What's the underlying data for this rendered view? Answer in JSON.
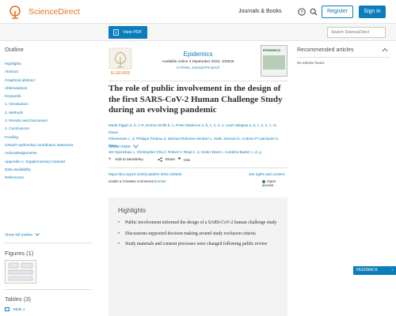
{
  "header": {
    "brand": "ScienceDirect",
    "journals_books": "Journals & Books",
    "register": "Register",
    "sign_in": "Sign in"
  },
  "toolbar": {
    "view_pdf": "View PDF",
    "search_placeholder": "Search ScienceDirect"
  },
  "outline": {
    "title": "Outline",
    "items": [
      "Highlights",
      "Abstract",
      "Graphical abstract",
      "Abbreviations",
      "Keywords",
      "1. Introduction",
      "2. Methods",
      "3. Results and Discussion",
      "4. Conclusions",
      "Funding",
      "CRediT authorship contribution statement",
      "Acknowledgements",
      "Appendix A. Supplementary material",
      "Data availability",
      "References"
    ],
    "show_full": "Show full outline"
  },
  "figures": {
    "title": "Figures (1)"
  },
  "tables": {
    "title": "Tables (3)",
    "table1": "Table 1"
  },
  "article": {
    "journal": "Epidemics",
    "available": "Available online 3 September 2022, 100626",
    "in_press": "In Press, Journal Pre-proof",
    "title": "The role of public involvement in the design of the first SARS-CoV-2 Human Challenge Study during an evolving pandemic",
    "authors_line1": "Maria Piggin a, b, 1 ✉, Emma Smith b, 1, Peter Mankone a, b, c, 2, 4, 1, Leah Ndegwa a, b, c, 2, 4, 1, ✉, Diane",
    "authors_line2": "Gbesemete c, d, Philippa Prideau d, Michael Rahman-Himbari c, Halle Johnson b, Andrew P Catchpole b, Peter",
    "authors_line3": "JM Openshaw c, Christopher Chiu f, Robert C Read c, d, Helen Ward c, Caroline Barker c, d, g",
    "show_more": "Show more",
    "add_mendeley": "Add to Mendeley",
    "share": "Share",
    "cite": "Cite",
    "doi": "https://doi.org/10.1016/j.epidem.2022.100626",
    "rights": "Get rights and content",
    "license_prefix": "Under a Creative Commons",
    "license_link": "license",
    "open_access": "Open access"
  },
  "highlights": {
    "title": "Highlights",
    "items": [
      "Public involvement informed the design of a SARS-CoV-2 human challenge study",
      "Discussions supported decision making around study exclusion criteria",
      "Study materials and consent processes were changed following public review"
    ]
  },
  "sidebar_right": {
    "title": "Recommended articles",
    "empty": "No articles found."
  },
  "feedback": "FEEDBACK",
  "colors": {
    "brand_orange": "#e9711c",
    "link_blue": "#0c7dbb"
  },
  "icons": [
    "elsevier-tree-icon",
    "help-icon",
    "search-icon",
    "pdf-icon",
    "plus-icon",
    "share-icon",
    "quote-icon",
    "chevron-down-icon"
  ]
}
